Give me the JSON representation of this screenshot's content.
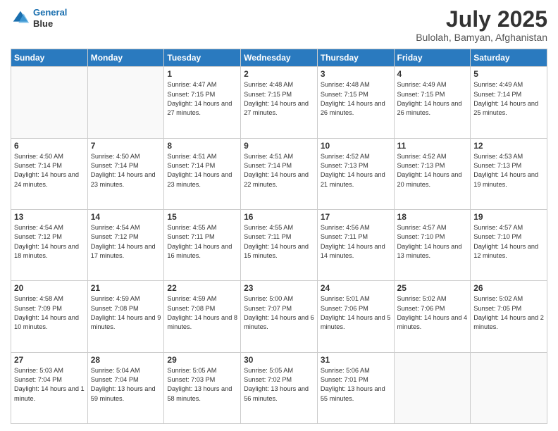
{
  "header": {
    "logo_line1": "General",
    "logo_line2": "Blue",
    "title": "July 2025",
    "subtitle": "Bulolah, Bamyan, Afghanistan"
  },
  "weekdays": [
    "Sunday",
    "Monday",
    "Tuesday",
    "Wednesday",
    "Thursday",
    "Friday",
    "Saturday"
  ],
  "weeks": [
    [
      {
        "day": "",
        "sunrise": "",
        "sunset": "",
        "daylight": ""
      },
      {
        "day": "",
        "sunrise": "",
        "sunset": "",
        "daylight": ""
      },
      {
        "day": "1",
        "sunrise": "Sunrise: 4:47 AM",
        "sunset": "Sunset: 7:15 PM",
        "daylight": "Daylight: 14 hours and 27 minutes."
      },
      {
        "day": "2",
        "sunrise": "Sunrise: 4:48 AM",
        "sunset": "Sunset: 7:15 PM",
        "daylight": "Daylight: 14 hours and 27 minutes."
      },
      {
        "day": "3",
        "sunrise": "Sunrise: 4:48 AM",
        "sunset": "Sunset: 7:15 PM",
        "daylight": "Daylight: 14 hours and 26 minutes."
      },
      {
        "day": "4",
        "sunrise": "Sunrise: 4:49 AM",
        "sunset": "Sunset: 7:15 PM",
        "daylight": "Daylight: 14 hours and 26 minutes."
      },
      {
        "day": "5",
        "sunrise": "Sunrise: 4:49 AM",
        "sunset": "Sunset: 7:14 PM",
        "daylight": "Daylight: 14 hours and 25 minutes."
      }
    ],
    [
      {
        "day": "6",
        "sunrise": "Sunrise: 4:50 AM",
        "sunset": "Sunset: 7:14 PM",
        "daylight": "Daylight: 14 hours and 24 minutes."
      },
      {
        "day": "7",
        "sunrise": "Sunrise: 4:50 AM",
        "sunset": "Sunset: 7:14 PM",
        "daylight": "Daylight: 14 hours and 23 minutes."
      },
      {
        "day": "8",
        "sunrise": "Sunrise: 4:51 AM",
        "sunset": "Sunset: 7:14 PM",
        "daylight": "Daylight: 14 hours and 23 minutes."
      },
      {
        "day": "9",
        "sunrise": "Sunrise: 4:51 AM",
        "sunset": "Sunset: 7:14 PM",
        "daylight": "Daylight: 14 hours and 22 minutes."
      },
      {
        "day": "10",
        "sunrise": "Sunrise: 4:52 AM",
        "sunset": "Sunset: 7:13 PM",
        "daylight": "Daylight: 14 hours and 21 minutes."
      },
      {
        "day": "11",
        "sunrise": "Sunrise: 4:52 AM",
        "sunset": "Sunset: 7:13 PM",
        "daylight": "Daylight: 14 hours and 20 minutes."
      },
      {
        "day": "12",
        "sunrise": "Sunrise: 4:53 AM",
        "sunset": "Sunset: 7:13 PM",
        "daylight": "Daylight: 14 hours and 19 minutes."
      }
    ],
    [
      {
        "day": "13",
        "sunrise": "Sunrise: 4:54 AM",
        "sunset": "Sunset: 7:12 PM",
        "daylight": "Daylight: 14 hours and 18 minutes."
      },
      {
        "day": "14",
        "sunrise": "Sunrise: 4:54 AM",
        "sunset": "Sunset: 7:12 PM",
        "daylight": "Daylight: 14 hours and 17 minutes."
      },
      {
        "day": "15",
        "sunrise": "Sunrise: 4:55 AM",
        "sunset": "Sunset: 7:11 PM",
        "daylight": "Daylight: 14 hours and 16 minutes."
      },
      {
        "day": "16",
        "sunrise": "Sunrise: 4:55 AM",
        "sunset": "Sunset: 7:11 PM",
        "daylight": "Daylight: 14 hours and 15 minutes."
      },
      {
        "day": "17",
        "sunrise": "Sunrise: 4:56 AM",
        "sunset": "Sunset: 7:11 PM",
        "daylight": "Daylight: 14 hours and 14 minutes."
      },
      {
        "day": "18",
        "sunrise": "Sunrise: 4:57 AM",
        "sunset": "Sunset: 7:10 PM",
        "daylight": "Daylight: 14 hours and 13 minutes."
      },
      {
        "day": "19",
        "sunrise": "Sunrise: 4:57 AM",
        "sunset": "Sunset: 7:10 PM",
        "daylight": "Daylight: 14 hours and 12 minutes."
      }
    ],
    [
      {
        "day": "20",
        "sunrise": "Sunrise: 4:58 AM",
        "sunset": "Sunset: 7:09 PM",
        "daylight": "Daylight: 14 hours and 10 minutes."
      },
      {
        "day": "21",
        "sunrise": "Sunrise: 4:59 AM",
        "sunset": "Sunset: 7:08 PM",
        "daylight": "Daylight: 14 hours and 9 minutes."
      },
      {
        "day": "22",
        "sunrise": "Sunrise: 4:59 AM",
        "sunset": "Sunset: 7:08 PM",
        "daylight": "Daylight: 14 hours and 8 minutes."
      },
      {
        "day": "23",
        "sunrise": "Sunrise: 5:00 AM",
        "sunset": "Sunset: 7:07 PM",
        "daylight": "Daylight: 14 hours and 6 minutes."
      },
      {
        "day": "24",
        "sunrise": "Sunrise: 5:01 AM",
        "sunset": "Sunset: 7:06 PM",
        "daylight": "Daylight: 14 hours and 5 minutes."
      },
      {
        "day": "25",
        "sunrise": "Sunrise: 5:02 AM",
        "sunset": "Sunset: 7:06 PM",
        "daylight": "Daylight: 14 hours and 4 minutes."
      },
      {
        "day": "26",
        "sunrise": "Sunrise: 5:02 AM",
        "sunset": "Sunset: 7:05 PM",
        "daylight": "Daylight: 14 hours and 2 minutes."
      }
    ],
    [
      {
        "day": "27",
        "sunrise": "Sunrise: 5:03 AM",
        "sunset": "Sunset: 7:04 PM",
        "daylight": "Daylight: 14 hours and 1 minute."
      },
      {
        "day": "28",
        "sunrise": "Sunrise: 5:04 AM",
        "sunset": "Sunset: 7:04 PM",
        "daylight": "Daylight: 13 hours and 59 minutes."
      },
      {
        "day": "29",
        "sunrise": "Sunrise: 5:05 AM",
        "sunset": "Sunset: 7:03 PM",
        "daylight": "Daylight: 13 hours and 58 minutes."
      },
      {
        "day": "30",
        "sunrise": "Sunrise: 5:05 AM",
        "sunset": "Sunset: 7:02 PM",
        "daylight": "Daylight: 13 hours and 56 minutes."
      },
      {
        "day": "31",
        "sunrise": "Sunrise: 5:06 AM",
        "sunset": "Sunset: 7:01 PM",
        "daylight": "Daylight: 13 hours and 55 minutes."
      },
      {
        "day": "",
        "sunrise": "",
        "sunset": "",
        "daylight": ""
      },
      {
        "day": "",
        "sunrise": "",
        "sunset": "",
        "daylight": ""
      }
    ]
  ]
}
